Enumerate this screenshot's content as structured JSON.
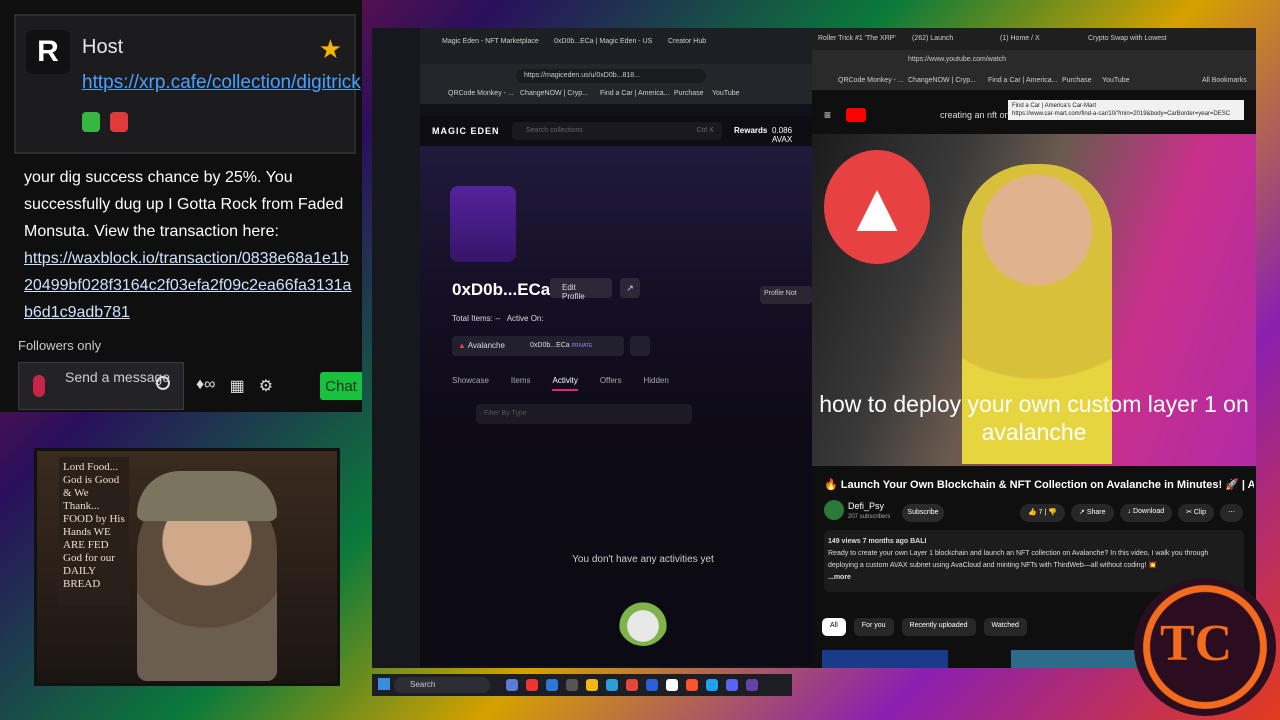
{
  "chat": {
    "host_initial": "R",
    "host_label": "Host",
    "host_link": "https://xrp.cafe/collection/digitrick",
    "message_line1": "your dig success chance by 25%. You successfully dug up I Gotta Rock from Faded Monsuta. View the transaction here:",
    "message_link": "https://waxblock.io/transaction/0838e68a1e1b20499bf028f3164c2f03efa2f09c2ea66fa3131ab6d1c9adb781",
    "followers_only": "Followers only",
    "send_placeholder": "Send a message",
    "chat_button": "Chat"
  },
  "webcam": {
    "sign_text": "Lord Food... God is Good & We Thank... FOOD by His Hands WE ARE FED God for our DAILY BREAD"
  },
  "magic_eden": {
    "tabs": [
      "Magic Eden - NFT Marketplace",
      "0xD0b...ECa | Magic Eden - US",
      "Creator Hub"
    ],
    "url": "https://magiceden.us/u/0xD0b...818...",
    "bookmarks": [
      "QRCode Monkey - ...",
      "ChangeNOW | Cryp...",
      "Find a Car | America...",
      "Purchase",
      "YouTube"
    ],
    "logo": "MAGIC EDEN",
    "search_placeholder": "Search collections",
    "search_shortcut": "Ctrl K",
    "rewards": "Rewards",
    "balance": "0.086 AVAX",
    "profile_note": "Profile Not",
    "profile_name": "0xD0b...ECa",
    "edit_profile": "Edit Profile",
    "total_items_label": "Total Items:",
    "total_items_value": "--",
    "active_on_label": "Active On:",
    "chain": "Avalanche",
    "wallet": "0xD0b...ECa",
    "wallet_badge": "PRIVATE",
    "profile_tabs": [
      "Showcase",
      "Items",
      "Activity",
      "Offers",
      "Hidden"
    ],
    "active_tab": "Activity",
    "filter_placeholder": "Filter By Type",
    "empty_text": "You don't have any activities yet"
  },
  "youtube": {
    "tabs": [
      "Roller Trick #1 'The XRP'",
      "(262) Launch",
      "(1) Home / X",
      "Crypto Swap with Lowest"
    ],
    "url": "https://www.youtube.com/watch",
    "bookmarks": [
      "QRCode Monkey - ...",
      "ChangeNOW | Cryp...",
      "Find a Car | America...",
      "Purchase",
      "YouTube",
      "All Bookmarks"
    ],
    "search_query": "creating an nft on av",
    "tooltip_line1": "Find a Car | America's Car-Mart",
    "tooltip_line2": "https://www.car-mart.com/find-a-car/10/?min=2019&body=CarBorder=year=DESC",
    "video_caption": "how to deploy your own custom layer 1 on avalanche",
    "video_title": "🔥 Launch Your Own Blockchain & NFT Collection on Avalanche in Minutes! 🚀 | AVAX Guide",
    "channel_name": "Defi_Psy",
    "channel_subs": "207 subscribers",
    "subscribe": "Subscribe",
    "likes": "7",
    "share": "Share",
    "download": "Download",
    "clip": "Clip",
    "views_line": "149 views  7 months ago  BALI",
    "description": "Ready to create your own Layer 1 blockchain and launch an NFT collection on Avalanche? In this video, I walk you through deploying a custom AVAX subnet using AvaCloud and minting NFTs with ThirdWeb—all without coding! 💥",
    "more": "...more",
    "chips": [
      "All",
      "For you",
      "Recently uploaded",
      "Watched"
    ]
  },
  "taskbar": {
    "search": "Search"
  },
  "badge": {
    "text": "TC"
  },
  "colors": {
    "accent_me": "#e42575",
    "yt_red": "#ff0000",
    "avax_red": "#e84142",
    "chat_green": "#19c23d"
  }
}
